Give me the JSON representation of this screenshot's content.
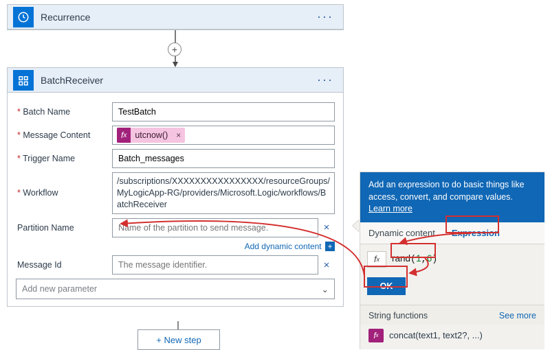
{
  "recurrence": {
    "title": "Recurrence",
    "icon": "clock-icon"
  },
  "batch": {
    "title": "BatchReceiver",
    "icon": "batch-icon",
    "rows": {
      "batch_name": {
        "label": "Batch Name",
        "value": "TestBatch"
      },
      "message_content": {
        "label": "Message Content",
        "fx_token": "utcnow()"
      },
      "trigger_name": {
        "label": "Trigger Name",
        "value": "Batch_messages"
      },
      "workflow": {
        "label": "Workflow",
        "value": "/subscriptions/XXXXXXXXXXXXXXXX/resourceGroups/MyLogicApp-RG/providers/Microsoft.Logic/workflows/BatchReceiver"
      },
      "partition_name": {
        "label": "Partition Name",
        "placeholder": "Name of the partition to send message."
      },
      "message_id": {
        "label": "Message Id",
        "placeholder": "The message identifier."
      }
    },
    "dynamic_link": "Add dynamic content",
    "add_parameter": "Add new parameter"
  },
  "new_step": "+ New step",
  "panel": {
    "head_text": "Add an expression to do basic things like access, convert, and compare values.",
    "learn_more": "Learn more",
    "tabs": {
      "dynamic": "Dynamic content",
      "expression": "Expression"
    },
    "expr_fn": "rand",
    "expr_args_a": "1",
    "expr_args_b": "6",
    "ok": "OK",
    "string_header": "String functions",
    "see_more": "See more",
    "fn_item": "concat(text1, text2?, ...)"
  }
}
